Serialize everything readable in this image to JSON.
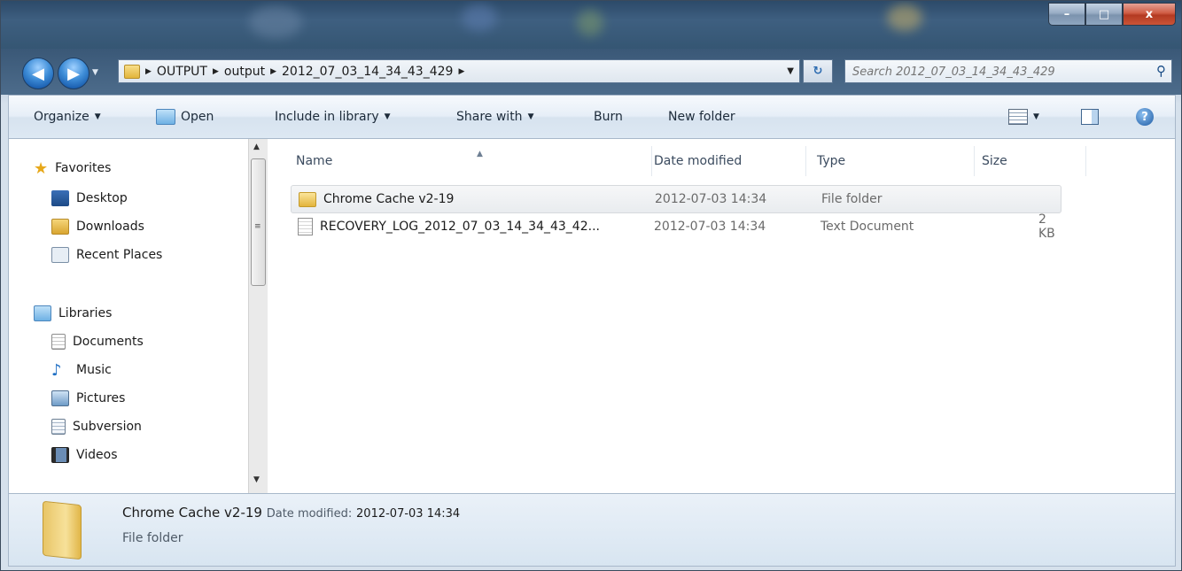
{
  "window": {
    "buttons": {
      "minimize": "–",
      "maximize": "□",
      "close": "x"
    }
  },
  "address": {
    "crumbs": [
      "OUTPUT",
      "output",
      "2012_07_03_14_34_43_429"
    ],
    "search_placeholder": "Search 2012_07_03_14_34_43_429"
  },
  "toolbar": {
    "organize": "Organize",
    "open": "Open",
    "include_in_library": "Include in library",
    "share_with": "Share with",
    "burn": "Burn",
    "new_folder": "New folder"
  },
  "nav": {
    "favorites": {
      "label": "Favorites",
      "items": [
        "Desktop",
        "Downloads",
        "Recent Places"
      ]
    },
    "libraries": {
      "label": "Libraries",
      "items": [
        "Documents",
        "Music",
        "Pictures",
        "Subversion",
        "Videos"
      ]
    }
  },
  "columns": [
    "Name",
    "Date modified",
    "Type",
    "Size"
  ],
  "files": [
    {
      "name": "Chrome Cache v2-19",
      "date": "2012-07-03 14:34",
      "type": "File folder",
      "size": ""
    },
    {
      "name": "RECOVERY_LOG_2012_07_03_14_34_43_42...",
      "date": "2012-07-03 14:34",
      "type": "Text Document",
      "size": "2 KB"
    }
  ],
  "details": {
    "name": "Chrome Cache v2-19",
    "date_label": "Date modified:",
    "date_value": "2012-07-03 14:34",
    "type": "File folder"
  }
}
